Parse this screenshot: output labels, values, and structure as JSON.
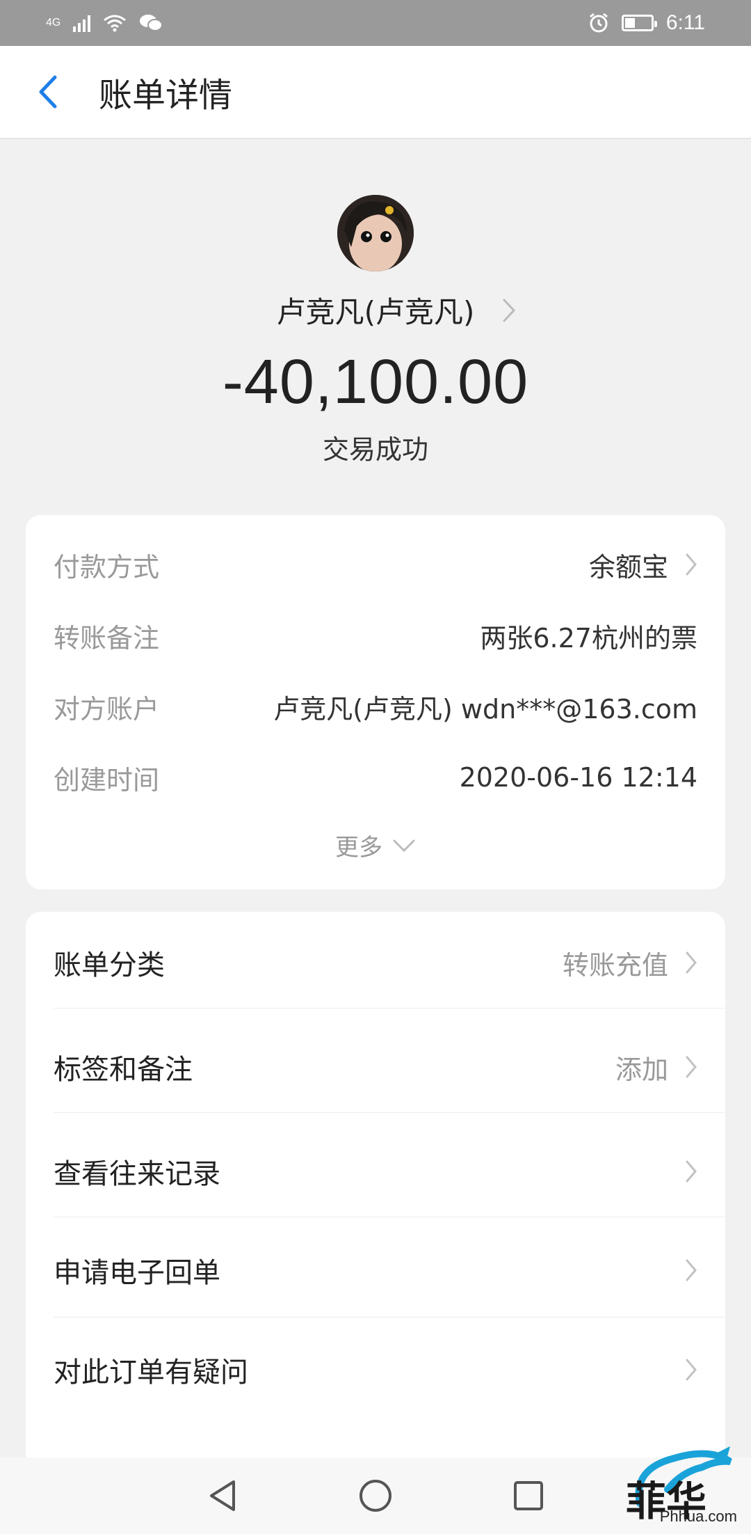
{
  "status_bar": {
    "network": "4G",
    "time": "6:11",
    "icons": [
      "signal-icon",
      "wifi-icon",
      "wechat-icon",
      "alarm-icon",
      "battery-icon"
    ]
  },
  "header": {
    "title": "账单详情",
    "back_icon": "chevron-left-icon",
    "accent": "#1e7fe8"
  },
  "summary": {
    "payee": "卢竞凡(卢竞凡)",
    "amount": "-40,100.00",
    "status": "交易成功"
  },
  "details": {
    "rows": [
      {
        "label": "付款方式",
        "value": "余额宝",
        "has_chevron": true
      },
      {
        "label": "转账备注",
        "value": "两张6.27杭州的票",
        "has_chevron": false
      },
      {
        "label": "对方账户",
        "value": "卢竞凡(卢竞凡) wdn***@163.com",
        "has_chevron": false
      },
      {
        "label": "创建时间",
        "value": "2020-06-16 12:14",
        "has_chevron": false
      }
    ],
    "more_label": "更多"
  },
  "menu": {
    "items": [
      {
        "label": "账单分类",
        "value": "转账充值"
      },
      {
        "label": "标签和备注",
        "value": "添加"
      },
      {
        "label": "查看往来记录",
        "value": ""
      },
      {
        "label": "申请电子回单",
        "value": ""
      },
      {
        "label": "对此订单有疑问",
        "value": ""
      }
    ]
  },
  "navbar": {
    "icons": [
      "back-triangle-icon",
      "home-circle-icon",
      "recents-square-icon"
    ]
  },
  "watermark": {
    "text": "Phhua.com"
  }
}
